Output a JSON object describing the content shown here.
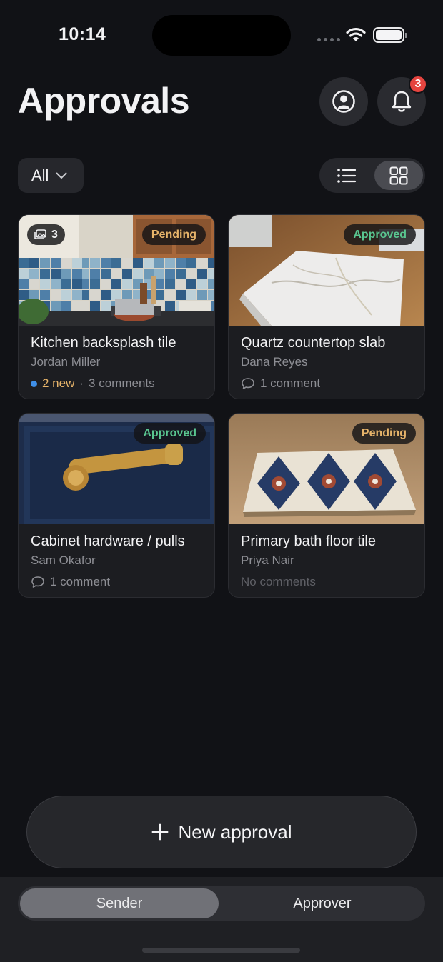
{
  "status_bar": {
    "time": "10:14"
  },
  "header": {
    "title": "Approvals",
    "notification_count": "3"
  },
  "filter": {
    "selected": "All"
  },
  "cards": [
    {
      "title": "Kitchen backsplash tile",
      "sender": "Jordan Miller",
      "status": "Pending",
      "photo_count": "3",
      "new_label": "2 new",
      "separator": "·",
      "comments": "3 comments"
    },
    {
      "title": "Quartz countertop slab",
      "sender": "Dana Reyes",
      "status": "Approved",
      "comments": "1 comment"
    },
    {
      "title": "Cabinet hardware / pulls",
      "sender": "Sam Okafor",
      "status": "Approved",
      "comments": "1 comment"
    },
    {
      "title": "Primary bath floor tile",
      "sender": "Priya Nair",
      "status": "Pending",
      "comments": "No comments"
    }
  ],
  "actions": {
    "new_approval": "New approval"
  },
  "mode_switch": {
    "sender": "Sender",
    "approver": "Approver",
    "selected": "Sender"
  },
  "colors": {
    "background": "#111216",
    "pending": "#e7b46a",
    "approved": "#59c690",
    "badge": "#e5443f",
    "new_dot": "#3f8fe8"
  },
  "icons": [
    "wifi-icon",
    "battery-icon",
    "profile-icon",
    "bell-icon",
    "chevron-down-icon",
    "list-view-icon",
    "grid-view-icon",
    "photos-icon",
    "comment-icon",
    "plus-icon"
  ]
}
